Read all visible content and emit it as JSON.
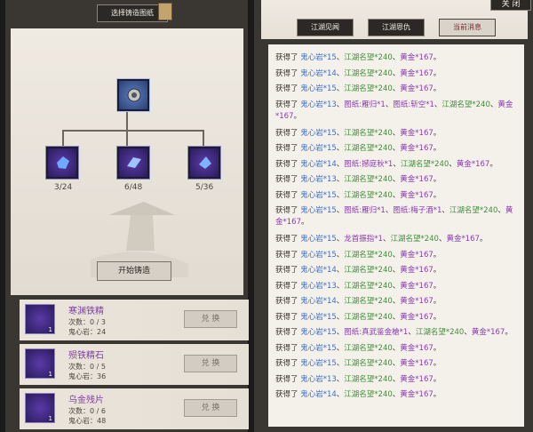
{
  "left": {
    "select_button": "选择铸造图纸",
    "start_button": "开始铸造",
    "nodes": [
      {
        "count": "3/24"
      },
      {
        "count": "6/48"
      },
      {
        "count": "5/36"
      }
    ],
    "materials": [
      {
        "name": "寒渊铁精",
        "times": "次数：0 / 3",
        "cost": "鬼心岩：24",
        "qty": "1",
        "exchange": "兑 换"
      },
      {
        "name": "殒铁精石",
        "times": "次数：0 / 5",
        "cost": "鬼心岩：36",
        "qty": "1",
        "exchange": "兑 换"
      },
      {
        "name": "乌金残片",
        "times": "次数：0 / 6",
        "cost": "鬼心岩：48",
        "qty": "1",
        "exchange": "兑 换"
      }
    ]
  },
  "right": {
    "close_button": "关 闭",
    "tabs": [
      "江湖见闻",
      "江湖恩仇",
      "当前消息"
    ],
    "messages": [
      {
        "lead": "获得了",
        "parts": [
          [
            "鬼心岩*15",
            "b"
          ],
          [
            "、",
            ""
          ],
          [
            "江湖名望*240",
            "g"
          ],
          [
            "、",
            ""
          ],
          [
            "黄金*167",
            "p"
          ],
          [
            "。",
            ""
          ]
        ]
      },
      {
        "lead": "获得了",
        "parts": [
          [
            "鬼心岩*14",
            "b"
          ],
          [
            "、",
            ""
          ],
          [
            "江湖名望*240",
            "g"
          ],
          [
            "、",
            ""
          ],
          [
            "黄金*167",
            "p"
          ],
          [
            "。",
            ""
          ]
        ]
      },
      {
        "lead": "获得了",
        "parts": [
          [
            "鬼心岩*15",
            "b"
          ],
          [
            "、",
            ""
          ],
          [
            "江湖名望*240",
            "g"
          ],
          [
            "、",
            ""
          ],
          [
            "黄金*167",
            "p"
          ],
          [
            "。",
            ""
          ]
        ]
      },
      {
        "lead": "获得了",
        "wrap": true,
        "parts": [
          [
            "鬼心岩*13",
            "b"
          ],
          [
            "、",
            ""
          ],
          [
            "图纸:雁归*1",
            "p"
          ],
          [
            "、",
            ""
          ],
          [
            "图纸:斩空*1",
            "p"
          ],
          [
            "、",
            ""
          ],
          [
            "江湖名望*240",
            "g"
          ],
          [
            "、",
            ""
          ],
          [
            "黄金*167",
            "p"
          ],
          [
            "。",
            ""
          ]
        ]
      },
      {
        "lead": "获得了",
        "parts": [
          [
            "鬼心岩*15",
            "b"
          ],
          [
            "、",
            ""
          ],
          [
            "江湖名望*240",
            "g"
          ],
          [
            "、",
            ""
          ],
          [
            "黄金*167",
            "p"
          ],
          [
            "。",
            ""
          ]
        ]
      },
      {
        "lead": "获得了",
        "parts": [
          [
            "鬼心岩*15",
            "b"
          ],
          [
            "、",
            ""
          ],
          [
            "江湖名望*240",
            "g"
          ],
          [
            "、",
            ""
          ],
          [
            "黄金*167",
            "p"
          ],
          [
            "。",
            ""
          ]
        ]
      },
      {
        "lead": "获得了",
        "parts": [
          [
            "鬼心岩*14",
            "b"
          ],
          [
            "、",
            ""
          ],
          [
            "图纸:撼庭秋*1",
            "p"
          ],
          [
            "、",
            ""
          ],
          [
            "江湖名望*240",
            "g"
          ],
          [
            "、",
            ""
          ],
          [
            "黄金*167",
            "p"
          ],
          [
            "。",
            ""
          ]
        ]
      },
      {
        "lead": "获得了",
        "parts": [
          [
            "鬼心岩*13",
            "b"
          ],
          [
            "、",
            ""
          ],
          [
            "江湖名望*240",
            "g"
          ],
          [
            "、",
            ""
          ],
          [
            "黄金*167",
            "p"
          ],
          [
            "。",
            ""
          ]
        ]
      },
      {
        "lead": "获得了",
        "parts": [
          [
            "鬼心岩*15",
            "b"
          ],
          [
            "、",
            ""
          ],
          [
            "江湖名望*240",
            "g"
          ],
          [
            "、",
            ""
          ],
          [
            "黄金*167",
            "p"
          ],
          [
            "。",
            ""
          ]
        ]
      },
      {
        "lead": "获得了",
        "wrap": true,
        "parts": [
          [
            "鬼心岩*15",
            "b"
          ],
          [
            "、",
            ""
          ],
          [
            "图纸:雁归*1",
            "p"
          ],
          [
            "、",
            ""
          ],
          [
            "图纸:梅子酒*1",
            "p"
          ],
          [
            "、",
            ""
          ],
          [
            "江湖名望*240",
            "g"
          ],
          [
            "、",
            ""
          ],
          [
            "黄金*167",
            "p"
          ],
          [
            "。",
            ""
          ]
        ]
      },
      {
        "lead": "获得了",
        "parts": [
          [
            "鬼心岩*15",
            "b"
          ],
          [
            "、",
            ""
          ],
          [
            "龙首振指*1",
            "p"
          ],
          [
            "、",
            ""
          ],
          [
            "江湖名望*240",
            "g"
          ],
          [
            "、",
            ""
          ],
          [
            "黄金*167",
            "p"
          ],
          [
            "。",
            ""
          ]
        ]
      },
      {
        "lead": "获得了",
        "parts": [
          [
            "鬼心岩*15",
            "b"
          ],
          [
            "、",
            ""
          ],
          [
            "江湖名望*240",
            "g"
          ],
          [
            "、",
            ""
          ],
          [
            "黄金*167",
            "p"
          ],
          [
            "。",
            ""
          ]
        ]
      },
      {
        "lead": "获得了",
        "parts": [
          [
            "鬼心岩*14",
            "b"
          ],
          [
            "、",
            ""
          ],
          [
            "江湖名望*240",
            "g"
          ],
          [
            "、",
            ""
          ],
          [
            "黄金*167",
            "p"
          ],
          [
            "。",
            ""
          ]
        ]
      },
      {
        "lead": "获得了",
        "parts": [
          [
            "鬼心岩*13",
            "b"
          ],
          [
            "、",
            ""
          ],
          [
            "江湖名望*240",
            "g"
          ],
          [
            "、",
            ""
          ],
          [
            "黄金*167",
            "p"
          ],
          [
            "。",
            ""
          ]
        ]
      },
      {
        "lead": "获得了",
        "parts": [
          [
            "鬼心岩*14",
            "b"
          ],
          [
            "、",
            ""
          ],
          [
            "江湖名望*240",
            "g"
          ],
          [
            "、",
            ""
          ],
          [
            "黄金*167",
            "p"
          ],
          [
            "。",
            ""
          ]
        ]
      },
      {
        "lead": "获得了",
        "parts": [
          [
            "鬼心岩*15",
            "b"
          ],
          [
            "、",
            ""
          ],
          [
            "江湖名望*240",
            "g"
          ],
          [
            "、",
            ""
          ],
          [
            "黄金*167",
            "p"
          ],
          [
            "。",
            ""
          ]
        ]
      },
      {
        "lead": "获得了",
        "parts": [
          [
            "鬼心岩*15",
            "b"
          ],
          [
            "、",
            ""
          ],
          [
            "图纸:真武鉴金槍*1",
            "p"
          ],
          [
            "、",
            ""
          ],
          [
            "江湖名望*240",
            "g"
          ],
          [
            "、",
            ""
          ],
          [
            "黄金*167",
            "p"
          ],
          [
            "。",
            ""
          ]
        ]
      },
      {
        "lead": "获得了",
        "parts": [
          [
            "鬼心岩*15",
            "b"
          ],
          [
            "、",
            ""
          ],
          [
            "江湖名望*240",
            "g"
          ],
          [
            "、",
            ""
          ],
          [
            "黄金*167",
            "p"
          ],
          [
            "。",
            ""
          ]
        ]
      },
      {
        "lead": "获得了",
        "parts": [
          [
            "鬼心岩*15",
            "b"
          ],
          [
            "、",
            ""
          ],
          [
            "江湖名望*240",
            "g"
          ],
          [
            "、",
            ""
          ],
          [
            "黄金*167",
            "p"
          ],
          [
            "。",
            ""
          ]
        ]
      },
      {
        "lead": "获得了",
        "parts": [
          [
            "鬼心岩*13",
            "b"
          ],
          [
            "、",
            ""
          ],
          [
            "江湖名望*240",
            "g"
          ],
          [
            "、",
            ""
          ],
          [
            "黄金*167",
            "p"
          ],
          [
            "。",
            ""
          ]
        ]
      },
      {
        "lead": "获得了",
        "parts": [
          [
            "鬼心岩*14",
            "b"
          ],
          [
            "、",
            ""
          ],
          [
            "江湖名望*240",
            "g"
          ],
          [
            "、",
            ""
          ],
          [
            "黄金*167",
            "p"
          ],
          [
            "。",
            ""
          ]
        ]
      }
    ]
  },
  "colors": {
    "blue": "#3c6fc4",
    "green": "#3f8f3a",
    "purple": "#8a3cb0"
  }
}
